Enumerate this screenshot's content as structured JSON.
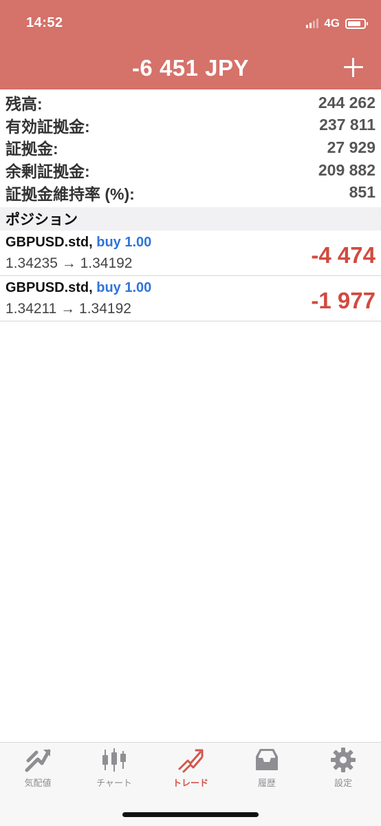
{
  "status_bar": {
    "time": "14:52",
    "network": "4G"
  },
  "header": {
    "title": "-6 451 JPY",
    "add_icon": "plus-icon"
  },
  "account": [
    {
      "label": "残高:",
      "value": "244 262"
    },
    {
      "label": "有効証拠金:",
      "value": "237 811"
    },
    {
      "label": "証拠金:",
      "value": "27 929"
    },
    {
      "label": "余剰証拠金:",
      "value": "209 882"
    },
    {
      "label": "証拠金維持率 (%):",
      "value": "851"
    }
  ],
  "positions_section": {
    "title": "ポジション"
  },
  "positions": [
    {
      "symbol": "GBPUSD.std,",
      "side": "buy 1.00",
      "prices": "1.34235 → 1.34192",
      "profit": "-4 474"
    },
    {
      "symbol": "GBPUSD.std,",
      "side": "buy 1.00",
      "prices": "1.34211 → 1.34192",
      "profit": "-1 977"
    }
  ],
  "tabs": [
    {
      "label": "気配値",
      "icon": "quotes-icon"
    },
    {
      "label": "チャート",
      "icon": "chart-icon"
    },
    {
      "label": "トレード",
      "icon": "trade-icon"
    },
    {
      "label": "履歴",
      "icon": "history-icon"
    },
    {
      "label": "設定",
      "icon": "settings-icon"
    }
  ],
  "colors": {
    "header_bg": "#d5726a",
    "profit_negative": "#d24a3f",
    "side_buy": "#2f74d9",
    "tab_active": "#d5564b",
    "tab_inactive": "#8e8e93"
  }
}
